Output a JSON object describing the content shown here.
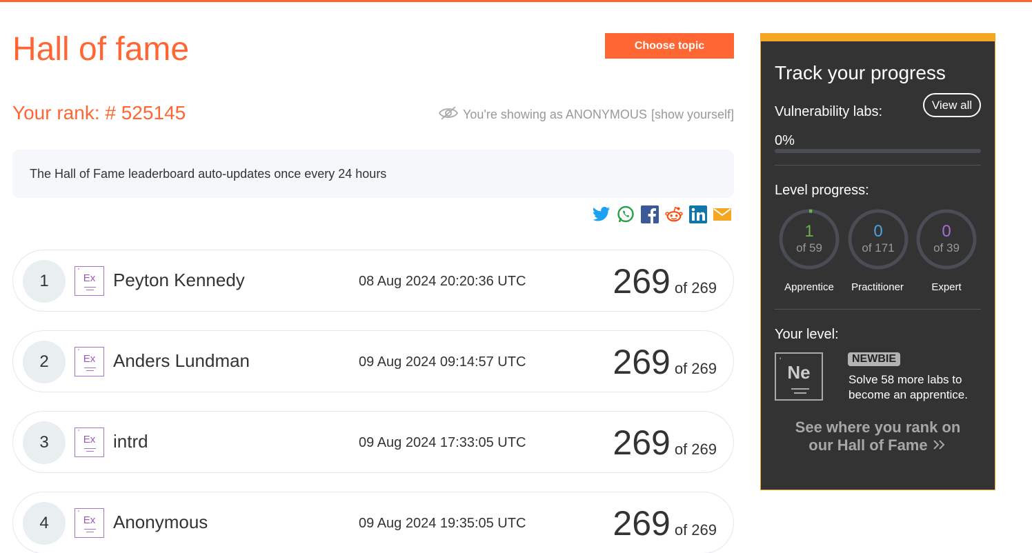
{
  "page": {
    "title": "Hall of fame",
    "choose_topic": "Choose topic",
    "rank": "Your rank: # 525145",
    "anonymous_note": "You're showing as ANONYMOUS",
    "show_yourself": "[show yourself]",
    "info": "The Hall of Fame leaderboard auto-updates once every 24 hours"
  },
  "share_icons": [
    "twitter-icon",
    "whatsapp-icon",
    "facebook-icon",
    "reddit-icon",
    "linkedin-icon",
    "email-icon"
  ],
  "leaderboard": [
    {
      "position": "1",
      "badge": "Ex",
      "name": "Peyton Kennedy",
      "date": "08 Aug 2024 20:20:36 UTC",
      "score": "269",
      "total": "of 269"
    },
    {
      "position": "2",
      "badge": "Ex",
      "name": "Anders Lundman",
      "date": "09 Aug 2024 09:14:57 UTC",
      "score": "269",
      "total": "of 269"
    },
    {
      "position": "3",
      "badge": "Ex",
      "name": "intrd",
      "date": "09 Aug 2024 17:33:05 UTC",
      "score": "269",
      "total": "of 269"
    },
    {
      "position": "4",
      "badge": "Ex",
      "name": "Anonymous",
      "date": "09 Aug 2024 19:35:05 UTC",
      "score": "269",
      "total": "of 269"
    }
  ],
  "sidebar": {
    "title": "Track your progress",
    "vuln_label": "Vulnerability labs:",
    "view_all": "View all",
    "vuln_percent": "0%",
    "vuln_progress": 0,
    "level_label": "Level progress:",
    "levels": [
      {
        "value": "1",
        "of": "of 59",
        "label": "Apprentice",
        "color": "#70b050",
        "fraction": 0.017
      },
      {
        "value": "0",
        "of": "of 171",
        "label": "Practitioner",
        "color": "#4aa3df",
        "fraction": 0
      },
      {
        "value": "0",
        "of": "of 39",
        "label": "Expert",
        "color": "#a36fd1",
        "fraction": 0
      }
    ],
    "your_level_label": "Your level:",
    "level_badge": "Ne",
    "level_name": "NEWBIE",
    "solve_text": "Solve 58 more labs to become an apprentice.",
    "see_rank": "See where you rank on our Hall of Fame"
  },
  "colors": {
    "accent": "#ff6633",
    "sidebar_bg": "#333333",
    "sidebar_border": "#f5a623",
    "expert_badge": "#a474c8"
  }
}
